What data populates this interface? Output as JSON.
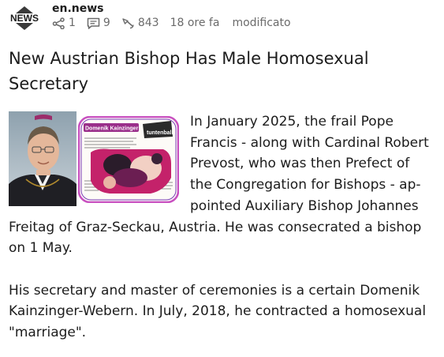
{
  "post": {
    "source_name": "en.news",
    "shares": "1",
    "comments": "9",
    "views": "843",
    "time_ago": "18 ore fa",
    "edited_label": "modificato"
  },
  "article": {
    "title": "New Austrian Bishop Has Male Homosexual Secretary",
    "paragraph_1": "In January 2025, the frail Pope Francis - along with Cardinal Robert Prevost, who was then Prefect of the Congregation for Bishops - ap­pointed Auxiliary Bishop Johannes Freitag of Graz-Seckau, Austria. He was consecrated a bishop on 1 May.",
    "paragraph_2": "His secretary and master of ceremonies is a certain Domenik Kainzinger-Webern. In July, 2018, he contracted a homosexual \"marriage\"."
  },
  "icons": [
    "news-logo-icon",
    "share-icon",
    "comment-icon",
    "views-icon"
  ],
  "colors": {
    "text": "#1c1c1c",
    "meta": "#6b6b6b",
    "clip_frame": "#c850c0"
  },
  "clipping": {
    "label": "Domenik Kainzinger",
    "badge": "tuntenball"
  }
}
